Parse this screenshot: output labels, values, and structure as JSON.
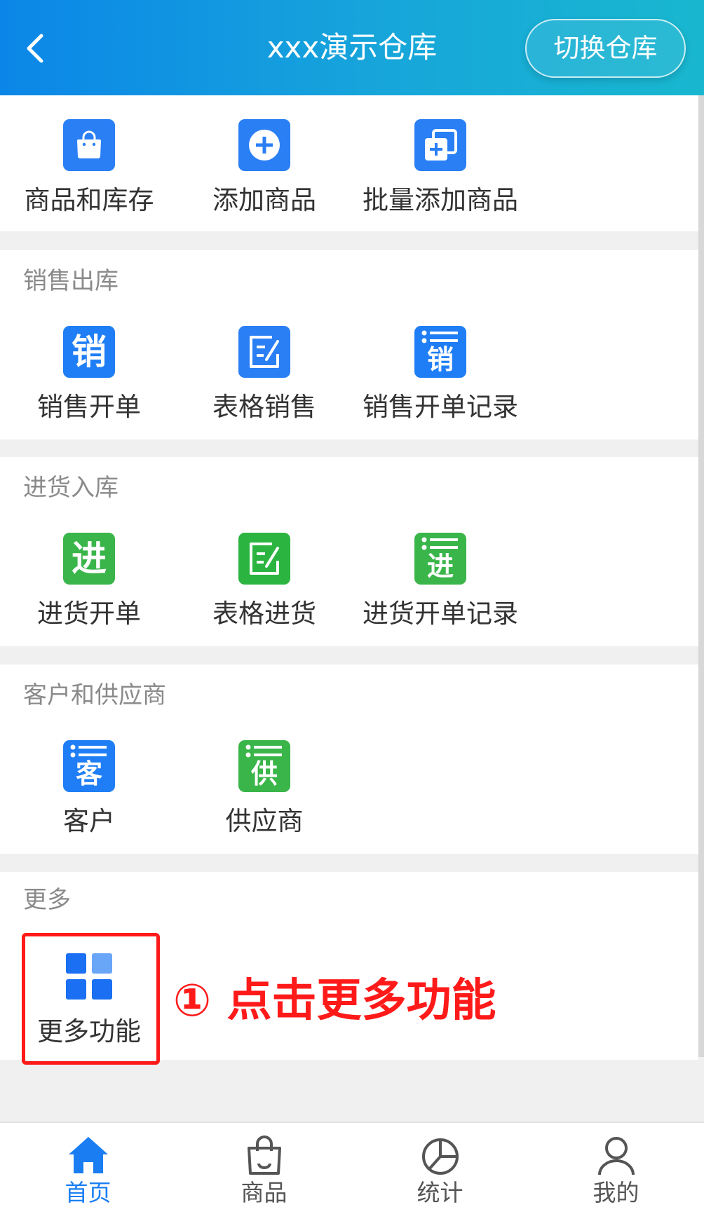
{
  "header": {
    "title": "xxx演示仓库",
    "switch_label": "切换仓库",
    "back_icon": "chevron-left-icon"
  },
  "top_section": {
    "items": [
      {
        "label": "商品和库存",
        "icon": "shopping-bag-icon",
        "color": "#2a7ff5"
      },
      {
        "label": "添加商品",
        "icon": "plus-circle-icon",
        "color": "#2a7ff5"
      },
      {
        "label": "批量添加商品",
        "icon": "batch-add-icon",
        "color": "#2a7ff5"
      }
    ]
  },
  "sales": {
    "title": "销售出库",
    "items": [
      {
        "label": "销售开单",
        "icon": "sales-order-icon",
        "glyph": "销",
        "color": "#1f7ef5"
      },
      {
        "label": "表格销售",
        "icon": "spreadsheet-edit-icon",
        "color": "#2a7ff5"
      },
      {
        "label": "销售开单记录",
        "icon": "sales-record-icon",
        "glyph": "销",
        "color": "#1f7ef5"
      }
    ]
  },
  "purchase": {
    "title": "进货入库",
    "items": [
      {
        "label": "进货开单",
        "icon": "purchase-order-icon",
        "glyph": "进",
        "color": "#3ab54a"
      },
      {
        "label": "表格进货",
        "icon": "spreadsheet-edit-icon",
        "color": "#2bb540"
      },
      {
        "label": "进货开单记录",
        "icon": "purchase-record-icon",
        "glyph": "进",
        "color": "#3ab54a"
      }
    ]
  },
  "partners": {
    "title": "客户和供应商",
    "items": [
      {
        "label": "客户",
        "icon": "customer-list-icon",
        "glyph": "客",
        "color": "#1f7ef5"
      },
      {
        "label": "供应商",
        "icon": "supplier-list-icon",
        "glyph": "供",
        "color": "#3ab54a"
      }
    ]
  },
  "more": {
    "title": "更多",
    "items": [
      {
        "label": "更多功能",
        "icon": "grid-icon",
        "color": "#1a6ff2"
      }
    ]
  },
  "annotation": {
    "text": "① 点击更多功能",
    "color": "#ff1a1a"
  },
  "bottom_nav": {
    "items": [
      {
        "label": "首页",
        "icon": "home-icon",
        "active": true
      },
      {
        "label": "商品",
        "icon": "shopping-bag-outline-icon",
        "active": false
      },
      {
        "label": "统计",
        "icon": "pie-chart-icon",
        "active": false
      },
      {
        "label": "我的",
        "icon": "user-icon",
        "active": false
      }
    ],
    "active_color": "#1a7ef2"
  }
}
